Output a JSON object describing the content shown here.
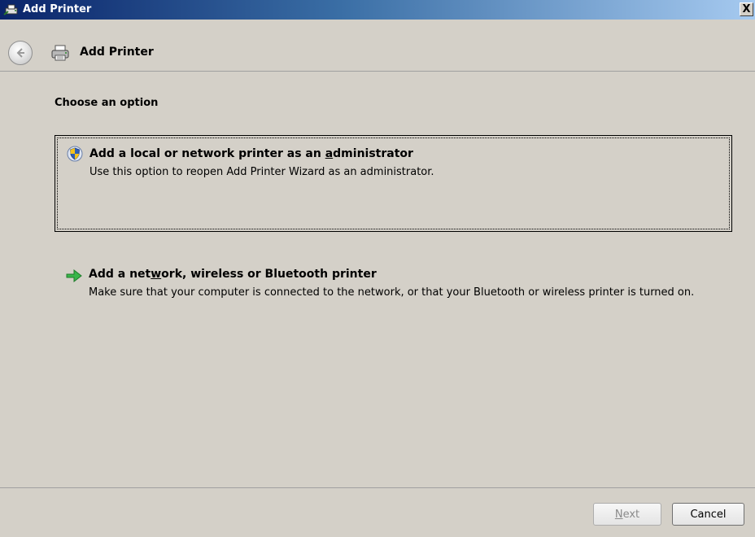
{
  "window": {
    "title": "Add Printer",
    "close_label": "X"
  },
  "nav": {
    "title": "Add Printer"
  },
  "main": {
    "heading": "Choose an option",
    "options": [
      {
        "title_pre": "Add a local or network printer as an ",
        "title_accel": "a",
        "title_post": "dministrator",
        "description": "Use this option to reopen Add Printer Wizard as an administrator.",
        "icon": "uac-shield-icon"
      },
      {
        "title_pre": "Add a net",
        "title_accel": "w",
        "title_post": "ork, wireless or Bluetooth printer",
        "description": "Make sure that your computer is connected to the network, or that your Bluetooth or wireless printer is turned on.",
        "icon": "green-arrow-icon"
      }
    ]
  },
  "footer": {
    "next_accel": "N",
    "next_rest": "ext",
    "cancel_label": "Cancel"
  },
  "colors": {
    "titlebar_start": "#0a246a",
    "titlebar_end": "#a6caf0",
    "background": "#d4d0c8"
  }
}
